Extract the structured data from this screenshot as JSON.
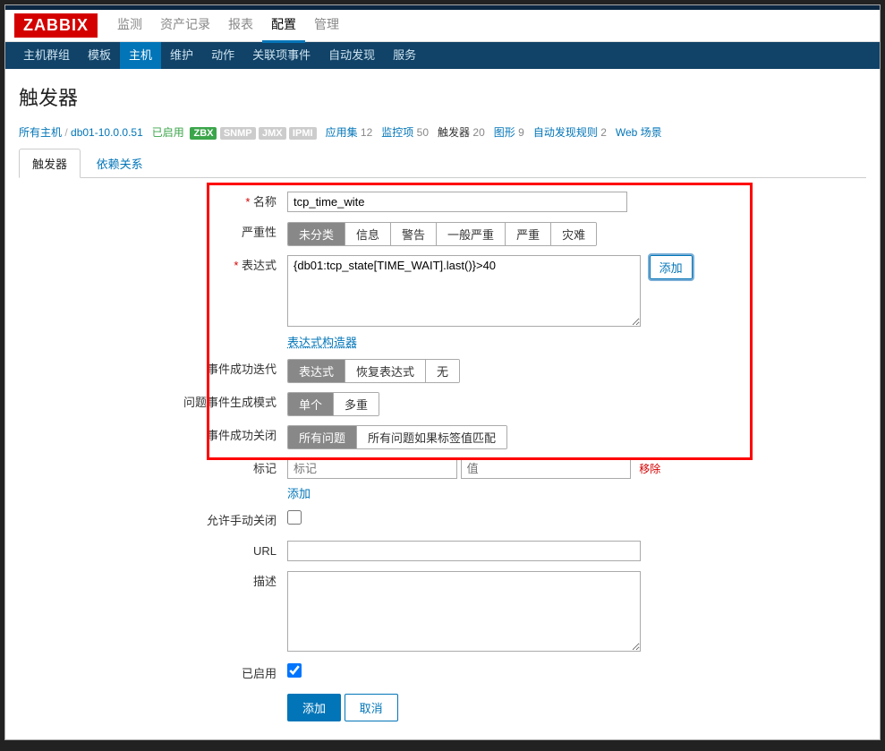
{
  "logo": "ZABBIX",
  "topnav": {
    "items": [
      "监测",
      "资产记录",
      "报表",
      "配置",
      "管理"
    ],
    "activeIndex": 3
  },
  "subnav": {
    "items": [
      "主机群组",
      "模板",
      "主机",
      "维护",
      "动作",
      "关联项事件",
      "自动发现",
      "服务"
    ],
    "activeIndex": 2
  },
  "pageTitle": "触发器",
  "crumb": {
    "allHosts": "所有主机",
    "host": "db01-10.0.0.51",
    "enabled": "已启用",
    "zbx": "ZBX",
    "snmp": "SNMP",
    "jmx": "JMX",
    "ipmi": "IPMI",
    "apps": {
      "label": "应用集",
      "count": "12"
    },
    "items": {
      "label": "监控项",
      "count": "50"
    },
    "triggers": {
      "label": "触发器",
      "count": "20"
    },
    "graphs": {
      "label": "图形",
      "count": "9"
    },
    "discovery": {
      "label": "自动发现规则",
      "count": "2"
    },
    "web": "Web 场景"
  },
  "tabs": {
    "trigger": "触发器",
    "deps": "依赖关系"
  },
  "form": {
    "nameLabel": "名称",
    "nameValue": "tcp_time_wite",
    "severityLabel": "严重性",
    "severity": [
      "未分类",
      "信息",
      "警告",
      "一般严重",
      "严重",
      "灾难"
    ],
    "exprLabel": "表达式",
    "exprValue": "{db01:tcp_state[TIME_WAIT].last()}>40",
    "exprAdd": "添加",
    "exprBuilder": "表达式构造器",
    "okGenLabel": "事件成功迭代",
    "okGen": [
      "表达式",
      "恢复表达式",
      "无"
    ],
    "problemModeLabel": "问题事件生成模式",
    "problemMode": [
      "单个",
      "多重"
    ],
    "okCloseLabel": "事件成功关闭",
    "okClose": [
      "所有问题",
      "所有问题如果标签值匹配"
    ],
    "tagsLabel": "标记",
    "tagNamePh": "标记",
    "tagValPh": "值",
    "tagRemove": "移除",
    "tagAdd": "添加",
    "allowManualLabel": "允许手动关闭",
    "urlLabel": "URL",
    "descLabel": "描述",
    "enabledLabel": "已启用",
    "submit": "添加",
    "cancel": "取消"
  }
}
